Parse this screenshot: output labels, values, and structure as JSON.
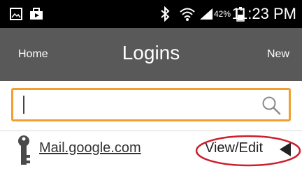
{
  "status_bar": {
    "icons": [
      "photo-icon",
      "bag-icon",
      "bluetooth-icon",
      "wifi-icon",
      "signal-icon",
      "battery-icon"
    ],
    "battery": "42%",
    "time": "11:23 PM"
  },
  "header": {
    "home_label": "Home",
    "title": "Logins",
    "new_label": "New"
  },
  "search": {
    "value": "",
    "placeholder": "",
    "icon": "search-icon"
  },
  "logins": [
    {
      "site": "Mail.google.com",
      "action_label": "View/Edit",
      "icon": "key-icon",
      "action_icon": "arrow-left-icon"
    }
  ],
  "colors": {
    "status_bar_bg": "#000000",
    "app_bar_bg": "#595959",
    "search_border": "#f0a030",
    "annotation": "#cc1f2e"
  }
}
